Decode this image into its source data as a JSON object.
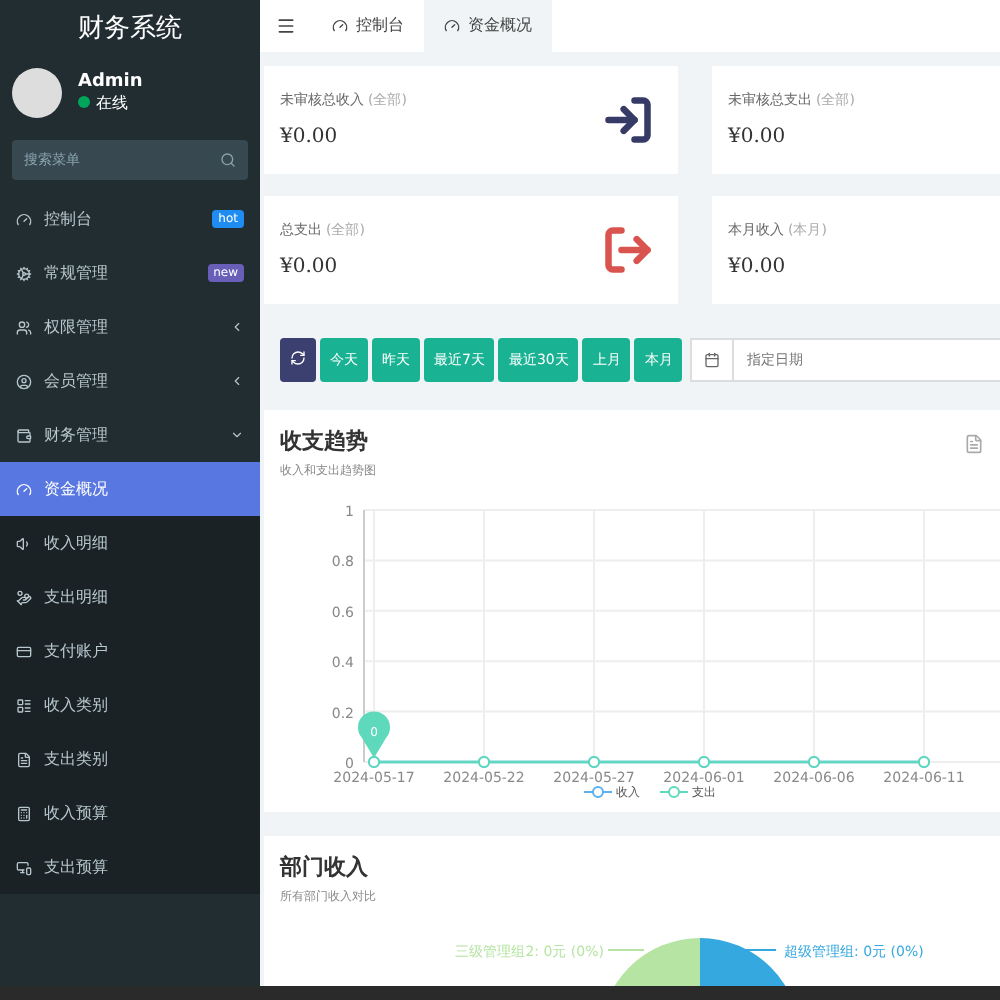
{
  "sidebar": {
    "title": "财务系统",
    "user": {
      "name": "Admin",
      "status": "在线"
    },
    "search": {
      "placeholder": "搜索菜单"
    },
    "items": [
      {
        "label": "控制台",
        "badge": {
          "text": "hot",
          "color": "#1e8cf0"
        }
      },
      {
        "label": "常规管理",
        "badge": {
          "text": "new",
          "color": "#6a5fb8"
        }
      },
      {
        "label": "权限管理",
        "expanded": false
      },
      {
        "label": "会员管理",
        "expanded": false
      },
      {
        "label": "财务管理",
        "expanded": true,
        "children": [
          {
            "label": "资金概况",
            "selected": true
          },
          {
            "label": "收入明细",
            "selected": false
          },
          {
            "label": "支出明细",
            "selected": false
          },
          {
            "label": "支付账户",
            "selected": false
          },
          {
            "label": "收入类别",
            "selected": false
          },
          {
            "label": "支出类别",
            "selected": false
          },
          {
            "label": "收入预算",
            "selected": false
          },
          {
            "label": "支出预算",
            "selected": false
          }
        ]
      }
    ]
  },
  "tabs": [
    {
      "label": "控制台",
      "selected": false
    },
    {
      "label": "资金概况",
      "selected": true
    }
  ],
  "stats": [
    {
      "label": "未审核总收入",
      "scope": "(全部)",
      "value": "¥0.00",
      "kind": "in"
    },
    {
      "label": "未审核总支出",
      "scope": "(全部)",
      "value": "¥0.00"
    },
    {
      "label": "总支出",
      "scope": "(全部)",
      "value": "¥0.00",
      "kind": "out"
    },
    {
      "label": "本月收入",
      "scope": "(本月)",
      "value": "¥0.00"
    }
  ],
  "filters": {
    "buttons": [
      "今天",
      "昨天",
      "最近7天",
      "最近30天",
      "上月",
      "本月"
    ],
    "date": {
      "placeholder": "指定日期"
    }
  },
  "trend": {
    "title": "收支趋势",
    "subtitle": "收入和支出趋势图",
    "chart_data": {
      "type": "line",
      "categories": [
        "2024-05-17",
        "2024-05-22",
        "2024-05-27",
        "2024-06-01",
        "2024-06-06",
        "2024-06-11"
      ],
      "series": [
        {
          "name": "收入",
          "color": "#5ab1ef",
          "marker": "circle",
          "values": [
            0,
            0,
            0,
            0,
            0,
            0
          ]
        },
        {
          "name": "支出",
          "color": "#5fd9bc",
          "marker": "circle",
          "values": [
            0,
            0,
            0,
            0,
            0,
            0
          ]
        }
      ],
      "ylim": [
        0,
        1
      ],
      "yticks": [
        0,
        0.2,
        0.4,
        0.6,
        0.8,
        1
      ],
      "grid": true,
      "annotations": [
        {
          "text": "0",
          "x": "2024-05-17",
          "y": 0
        }
      ]
    }
  },
  "department": {
    "title": "部门收入",
    "subtitle": "所有部门收入对比",
    "slices": [
      {
        "label": "三级管理组2: 0元 (0%)",
        "color": "#b6e4a2"
      },
      {
        "label": "超级管理组: 0元 (0%)",
        "color": "#36a8e0"
      }
    ]
  }
}
